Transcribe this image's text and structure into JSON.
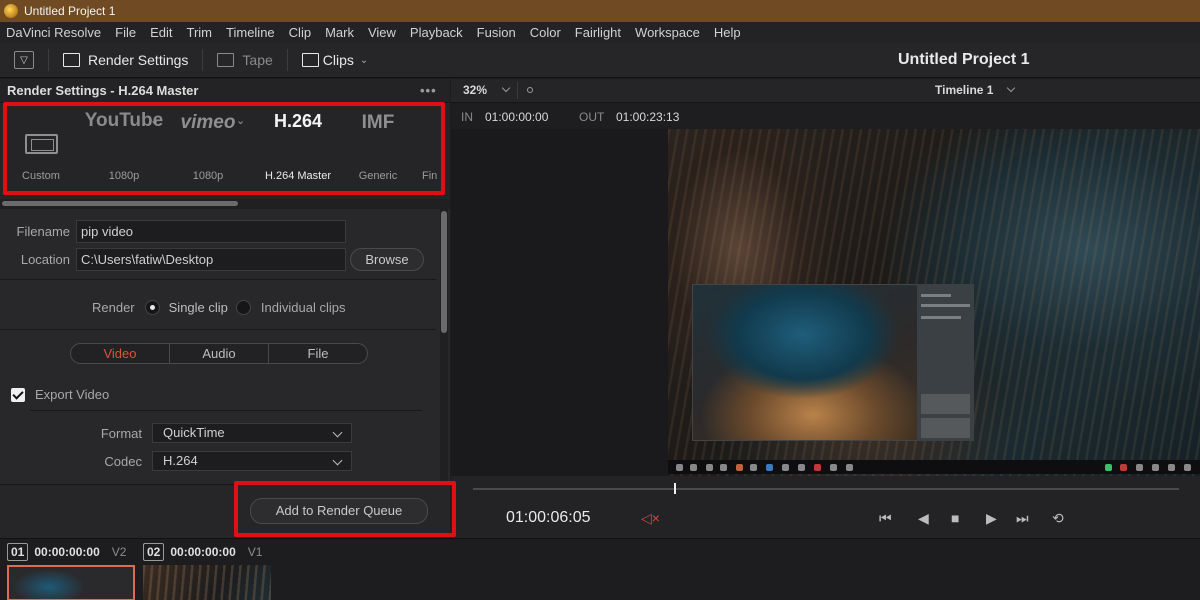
{
  "window": {
    "title": "Untitled Project 1"
  },
  "menu": [
    "DaVinci Resolve",
    "File",
    "Edit",
    "Trim",
    "Timeline",
    "Clip",
    "Mark",
    "View",
    "Playback",
    "Fusion",
    "Color",
    "Fairlight",
    "Workspace",
    "Help"
  ],
  "toolbar": {
    "render_settings_label": "Render Settings",
    "tape_label": "Tape",
    "clips_label": "Clips",
    "project_title": "Untitled Project 1"
  },
  "render_panel": {
    "title": "Render Settings - H.264 Master",
    "presets": [
      {
        "logo": "",
        "label": "Custom",
        "icon": "film-icon"
      },
      {
        "logo": "YouTube",
        "label": "1080p",
        "icon": "chevron-down-icon"
      },
      {
        "logo": "vimeo",
        "label": "1080p",
        "icon": "chevron-down-icon"
      },
      {
        "logo": "H.264",
        "label": "H.264 Master",
        "selected": true
      },
      {
        "logo": "IMF",
        "label": "Generic"
      },
      {
        "logo": "",
        "label": "Fin"
      }
    ],
    "filename_label": "Filename",
    "filename_value": "pip video",
    "location_label": "Location",
    "location_value": "C:\\Users\\fatiw\\Desktop",
    "browse_label": "Browse",
    "render_label": "Render",
    "single_clip_label": "Single clip",
    "individual_clips_label": "Individual clips",
    "tabs": [
      "Video",
      "Audio",
      "File"
    ],
    "export_video_label": "Export Video",
    "format_label": "Format",
    "format_value": "QuickTime",
    "codec_label": "Codec",
    "codec_value": "H.264",
    "add_to_queue_label": "Add to Render Queue"
  },
  "viewer": {
    "zoom": "32%",
    "timeline_name": "Timeline 1",
    "in_label": "IN",
    "in_value": "01:00:00:00",
    "out_label": "OUT",
    "out_value": "01:00:23:13",
    "timecode": "01:00:06:05",
    "playhead_fraction": 0.285
  },
  "clips": [
    {
      "num": "01",
      "timecode": "00:00:00:00",
      "track": "V2"
    },
    {
      "num": "02",
      "timecode": "00:00:00:00",
      "track": "V1"
    }
  ],
  "colors": {
    "accent_red": "#e0513f",
    "highlight_box": "#e00f14",
    "title_bar": "#6f4a22"
  }
}
